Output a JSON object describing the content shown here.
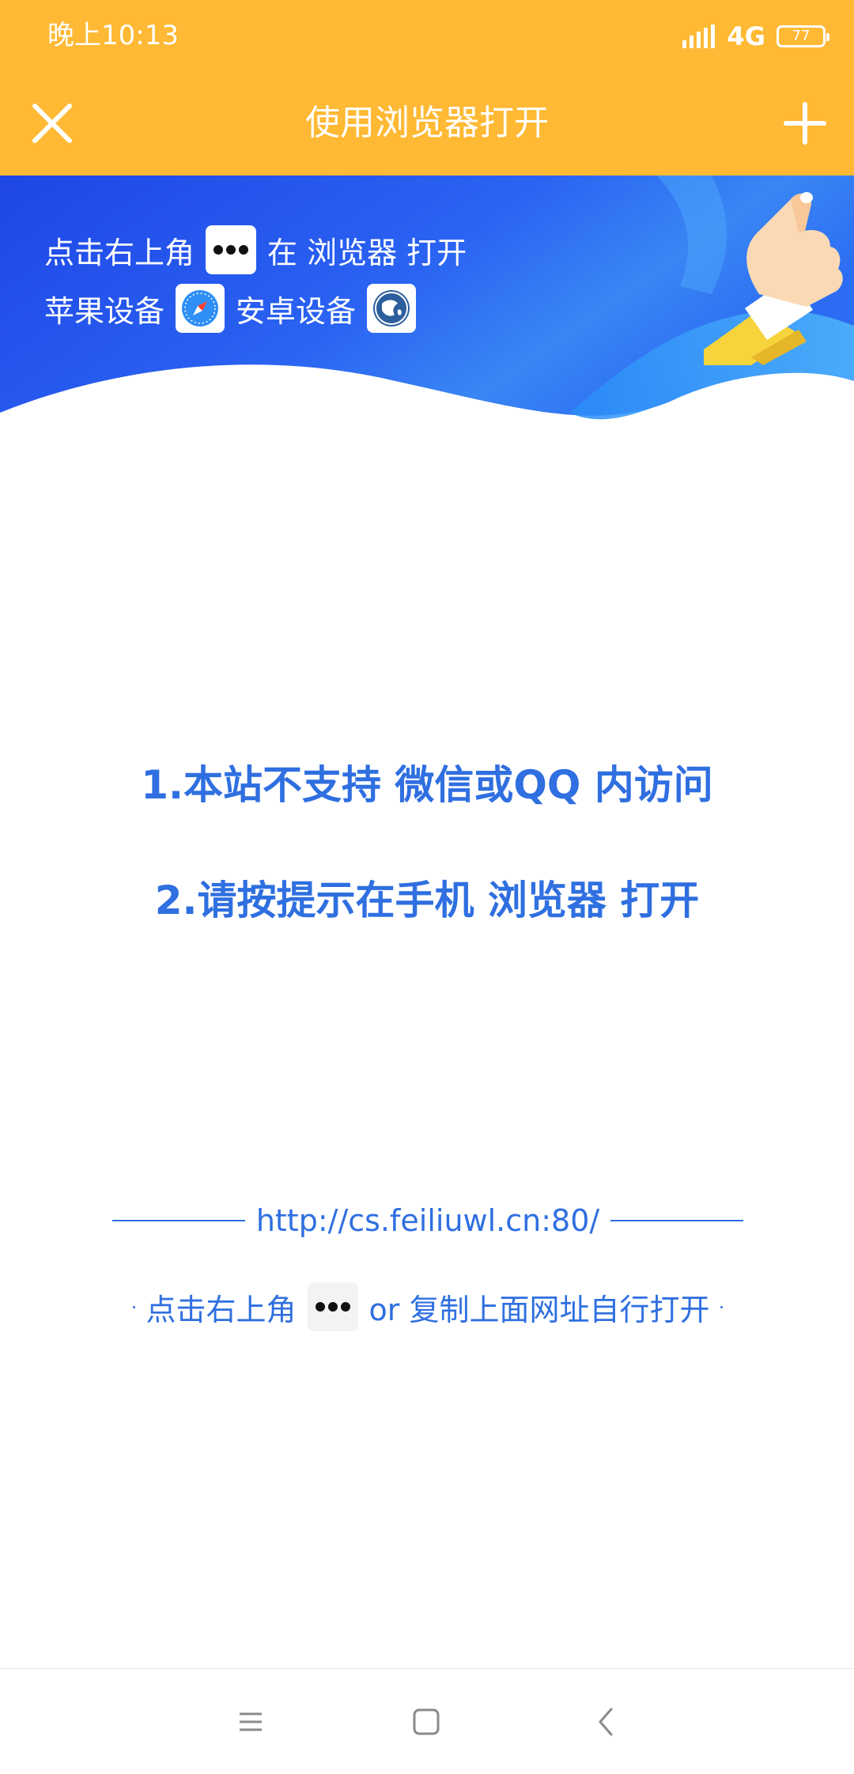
{
  "status_bar": {
    "time": "晚上10:13",
    "network": "4G",
    "battery": "77"
  },
  "title_bar": {
    "title": "使用浏览器打开",
    "close_icon": "close-icon",
    "add_icon": "plus-icon"
  },
  "banner": {
    "line1_prefix": "点击右上角",
    "line1_suffix": "在 浏览器 打开",
    "line2_apple": "苹果设备",
    "line2_android": "安卓设备"
  },
  "notice": {
    "line1": "1.本站不支持 微信或QQ 内访问",
    "line2": "2.请按提示在手机 浏览器 打开"
  },
  "url": {
    "text": "http://cs.feiliuwl.cn:80/"
  },
  "hint": {
    "prefix": "点击右上角",
    "suffix": "or 复制上面网址自行打开"
  },
  "colors": {
    "header": "#FFB934",
    "accent_blue": "#2F6FE0",
    "banner_blue": "#2457F0"
  }
}
